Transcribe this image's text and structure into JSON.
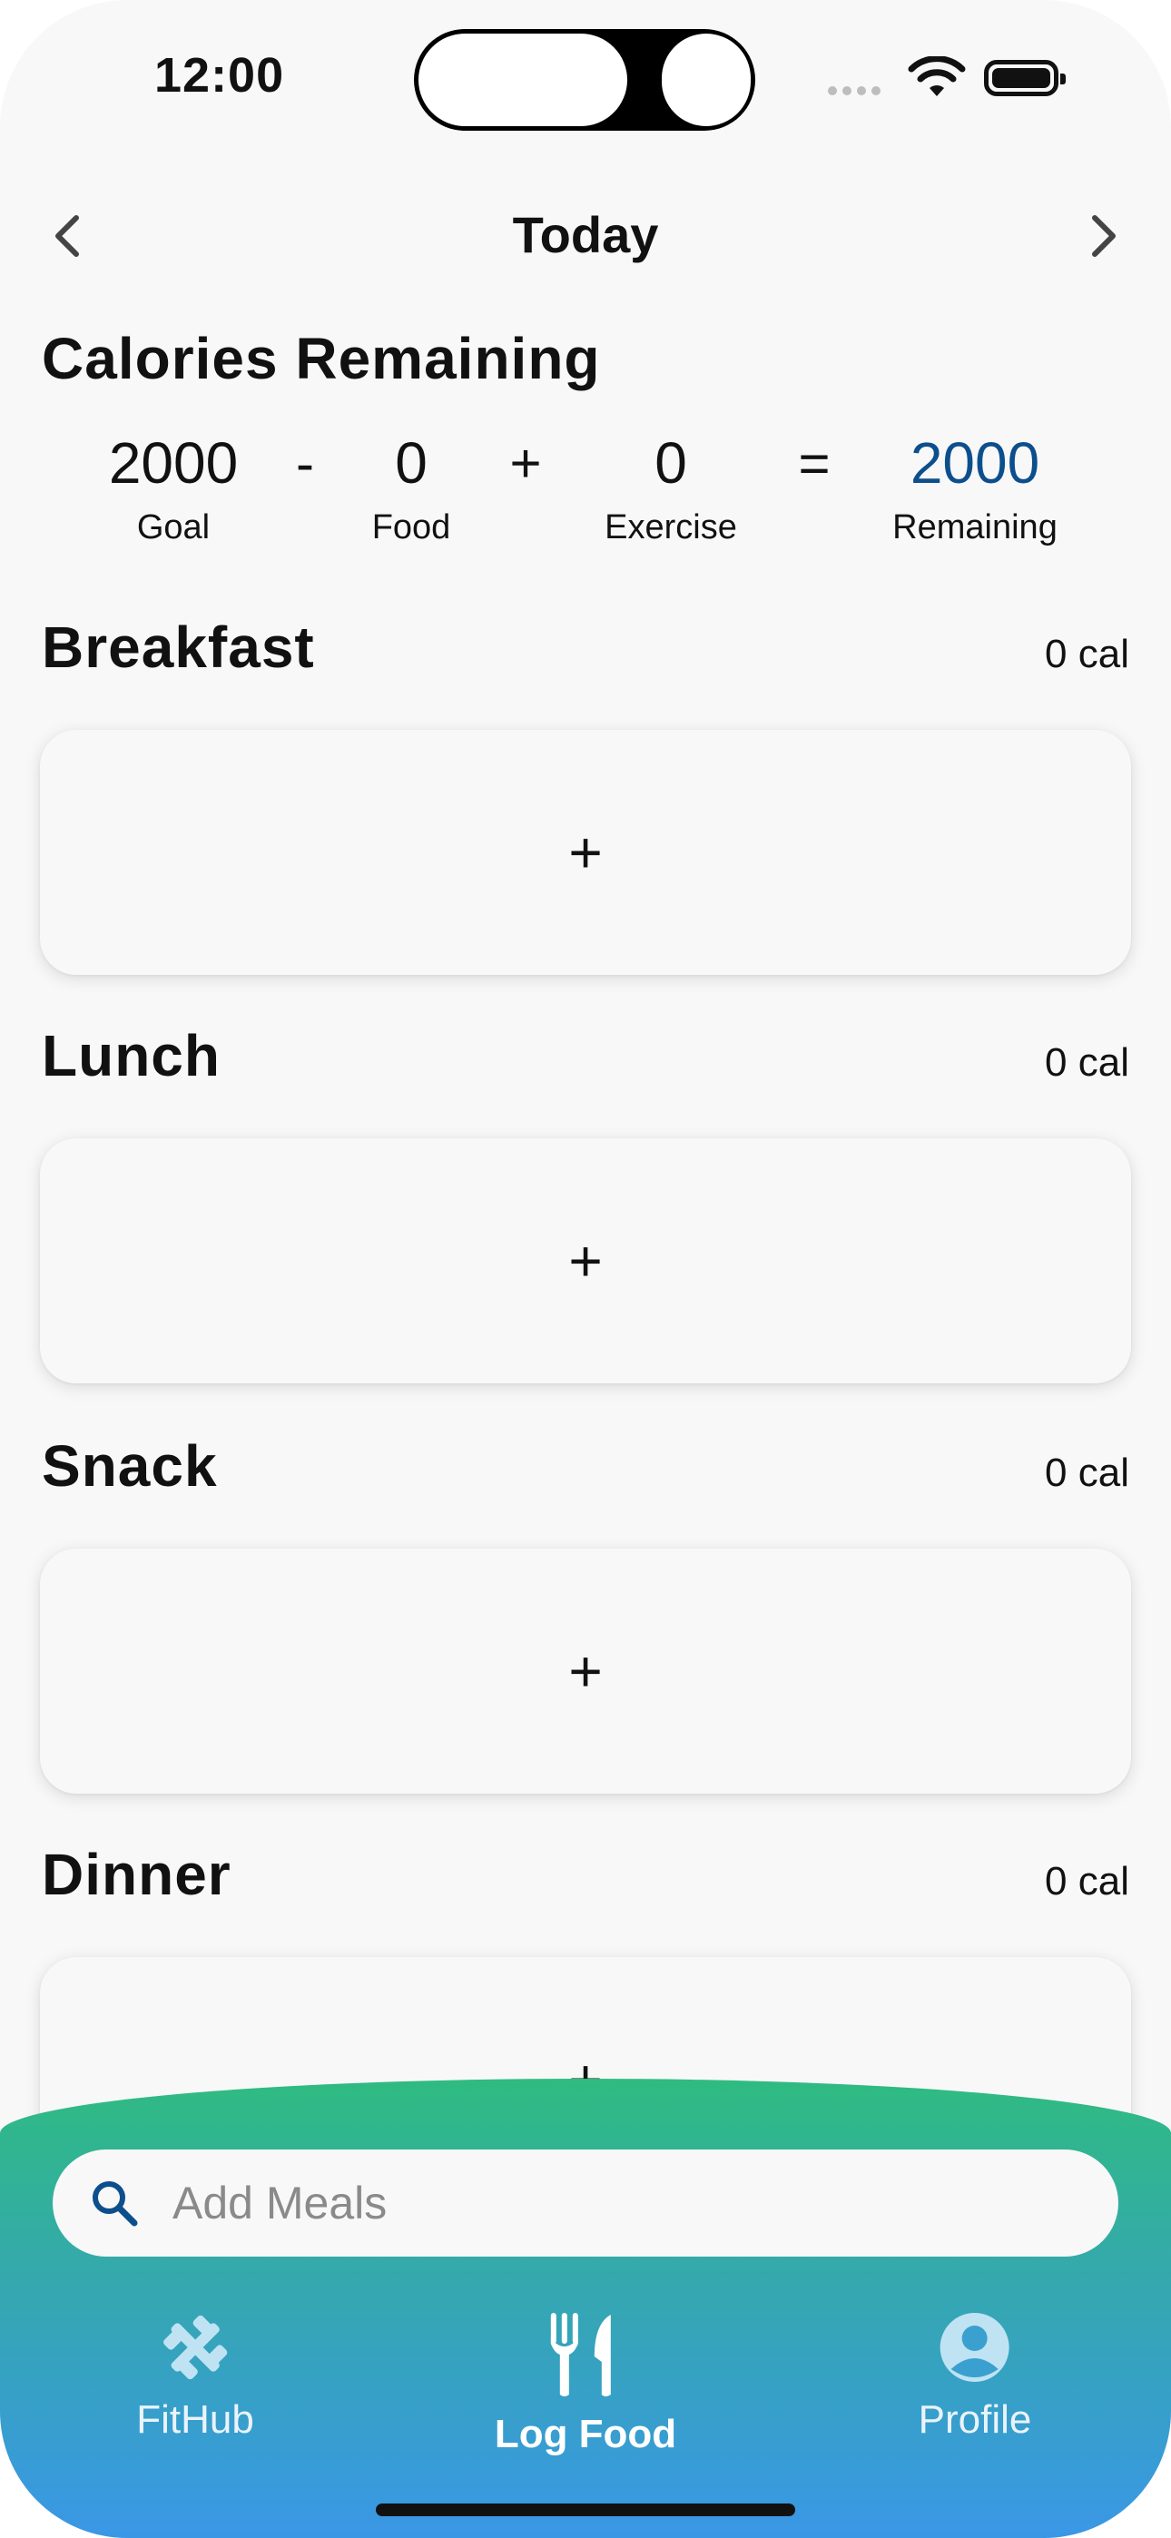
{
  "status_bar": {
    "time": "12:00"
  },
  "header": {
    "title": "Today",
    "prev_icon": "chevron-left-icon",
    "next_icon": "chevron-right-icon"
  },
  "calories": {
    "heading": "Calories Remaining",
    "goal": {
      "value": "2000",
      "label": "Goal"
    },
    "op_minus": "-",
    "food": {
      "value": "0",
      "label": "Food"
    },
    "op_plus": "+",
    "exercise": {
      "value": "0",
      "label": "Exercise"
    },
    "op_equals": "=",
    "remaining": {
      "value": "2000",
      "label": "Remaining"
    },
    "remaining_color": "#0d4f8c"
  },
  "meals": [
    {
      "name": "Breakfast",
      "cal": "0 cal",
      "add": "+"
    },
    {
      "name": "Lunch",
      "cal": "0 cal",
      "add": "+"
    },
    {
      "name": "Snack",
      "cal": "0 cal",
      "add": "+"
    },
    {
      "name": "Dinner",
      "cal": "0 cal",
      "add": "+"
    }
  ],
  "search": {
    "placeholder": "Add Meals",
    "icon": "search-icon"
  },
  "tabs": [
    {
      "label": "FitHub",
      "icon": "dumbbell-icon",
      "active": false
    },
    {
      "label": "Log Food",
      "icon": "fork-knife-icon",
      "active": true
    },
    {
      "label": "Profile",
      "icon": "profile-icon",
      "active": false
    }
  ],
  "colors": {
    "gradient_top": "#2fbb81",
    "gradient_bottom": "#3a97e6",
    "background": "#f8f8f8"
  }
}
